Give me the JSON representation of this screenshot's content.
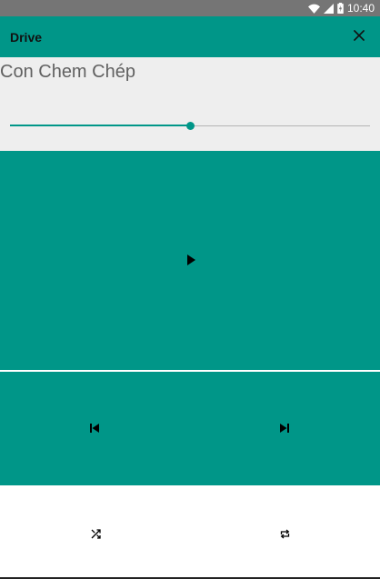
{
  "status_bar": {
    "time": "10:40",
    "icons": [
      "wifi-icon",
      "cellular-signal-icon",
      "battery-charging-icon"
    ]
  },
  "app_bar": {
    "title": "Drive",
    "close_icon": "close-icon"
  },
  "player": {
    "track_title": "Con Chem Chép",
    "progress_fraction": 0.5,
    "controls": {
      "play_icon": "play-icon",
      "previous_icon": "skip-previous-icon",
      "next_icon": "skip-next-icon",
      "shuffle_icon": "shuffle-icon",
      "repeat_icon": "repeat-icon"
    }
  },
  "colors": {
    "accent": "#009688",
    "status_bar": "#757575",
    "track_panel_bg": "#eeeeee",
    "title_text": "#616161",
    "icon": "#000000"
  }
}
